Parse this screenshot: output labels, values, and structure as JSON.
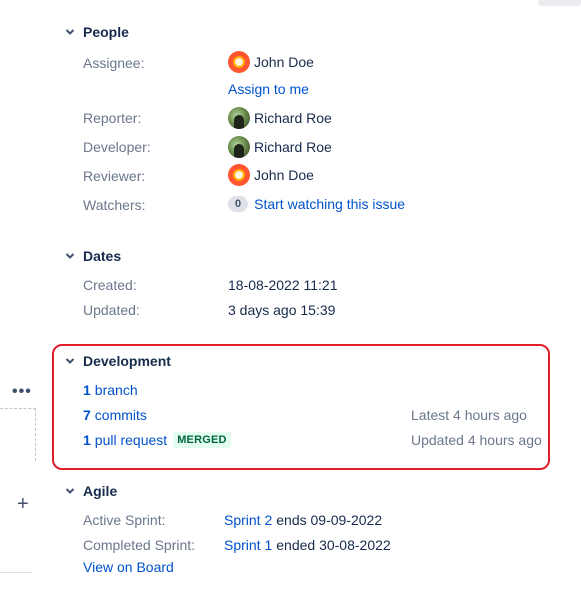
{
  "people": {
    "title": "People",
    "assignee": {
      "label": "Assignee:",
      "name": "John Doe",
      "assign_to_me": "Assign to me"
    },
    "reporter": {
      "label": "Reporter:",
      "name": "Richard Roe"
    },
    "developer": {
      "label": "Developer:",
      "name": "Richard Roe"
    },
    "reviewer": {
      "label": "Reviewer:",
      "name": "John Doe"
    },
    "watchers": {
      "label": "Watchers:",
      "count": "0",
      "action": "Start watching this issue"
    }
  },
  "dates": {
    "title": "Dates",
    "created": {
      "label": "Created:",
      "value": "18-08-2022 11:21"
    },
    "updated": {
      "label": "Updated:",
      "value": "3 days ago 15:39"
    }
  },
  "development": {
    "title": "Development",
    "branch": {
      "count": "1",
      "label": "branch"
    },
    "commits": {
      "count": "7",
      "label": "commits",
      "meta": "Latest 4 hours ago"
    },
    "pull_request": {
      "count": "1",
      "label": "pull request",
      "status": "MERGED",
      "meta": "Updated 4 hours ago"
    }
  },
  "agile": {
    "title": "Agile",
    "active_sprint": {
      "label": "Active Sprint:",
      "sprint": "Sprint 2",
      "suffix": "ends 09-09-2022"
    },
    "completed_sprint": {
      "label": "Completed Sprint:",
      "sprint": "Sprint 1",
      "suffix": "ended 30-08-2022"
    },
    "view_on_board": "View on Board"
  },
  "side": {
    "more_icon": "more-icon",
    "add_icon": "plus-icon"
  },
  "colors": {
    "link": "#0052cc",
    "highlight_border": "#e01e28",
    "merged_bg": "#e3fcef",
    "merged_text": "#006644"
  }
}
